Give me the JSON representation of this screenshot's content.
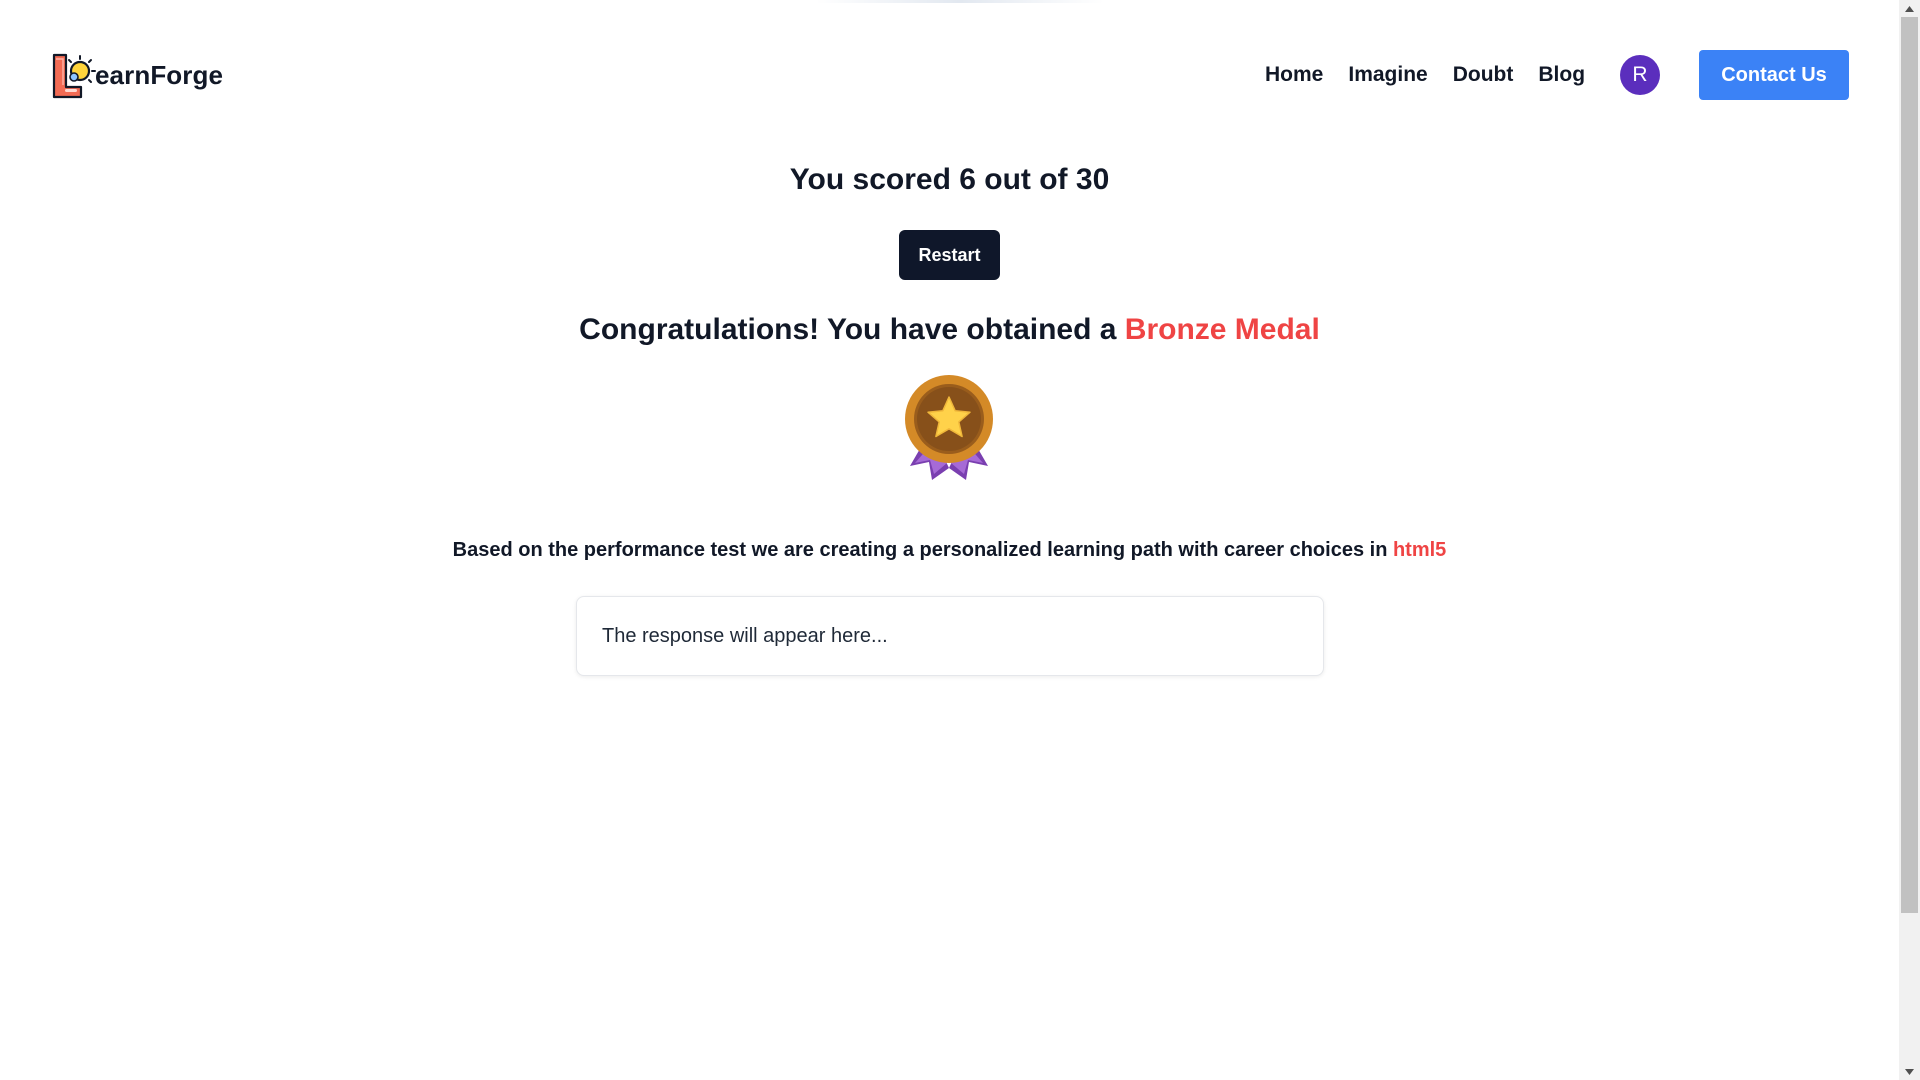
{
  "header": {
    "brand_text": "earnForge",
    "nav_items": [
      {
        "label": "Home"
      },
      {
        "label": "Imagine"
      },
      {
        "label": "Doubt"
      },
      {
        "label": "Blog"
      }
    ],
    "avatar_initial": "R",
    "contact_label": "Contact Us"
  },
  "main": {
    "score_text": "You scored 6 out of 30",
    "restart_label": "Restart",
    "congrats_prefix": "Congratulations! You have obtained a ",
    "medal_name": "Bronze Medal",
    "medal_icon": "bronze-medal-icon",
    "path_prefix": "Based on the performance test we are creating a personalized learning path with career choices in ",
    "path_topic": "html5",
    "response_text": "The response will appear here..."
  },
  "colors": {
    "accent_red": "#ef4444",
    "contact_blue": "#3b82f6",
    "avatar_purple": "#5b2ebd",
    "restart_dark": "#0f172a",
    "medal_gold": "#d28a2c",
    "ribbon_purple": "#9b59d0"
  }
}
